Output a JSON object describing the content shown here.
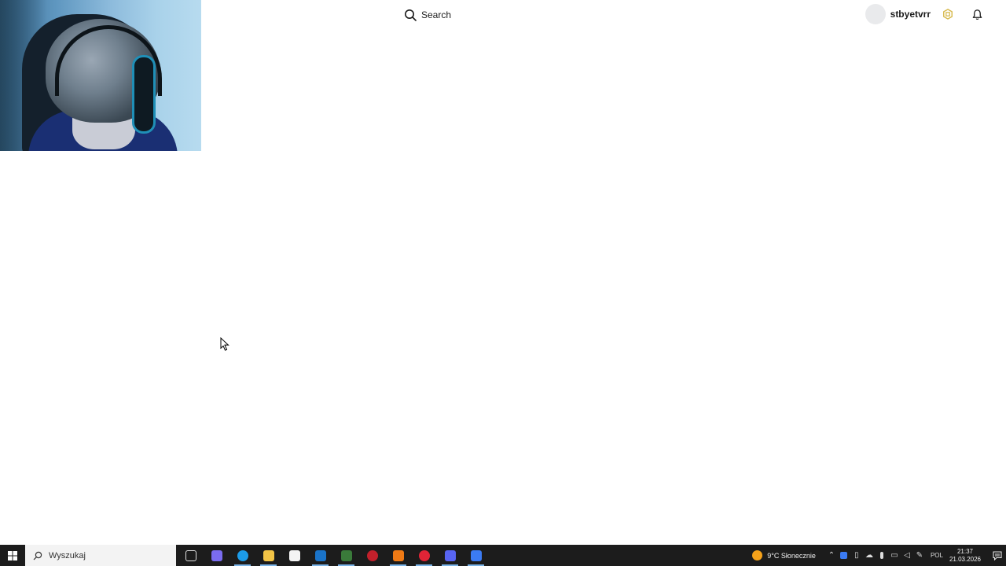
{
  "header": {
    "search_label": "Search",
    "username": "stbyetvrr"
  },
  "taskbar": {
    "search_placeholder": "Wyszukaj",
    "apps": [
      {
        "name": "task-view",
        "color": "#e0e0e0"
      },
      {
        "name": "copilot",
        "color": "#7a6cf0"
      },
      {
        "name": "edge",
        "color": "#1c9be8"
      },
      {
        "name": "file-explorer",
        "color": "#f3c446"
      },
      {
        "name": "microsoft-store",
        "color": "#f4f4f4"
      },
      {
        "name": "outlook",
        "color": "#1a73c8"
      },
      {
        "name": "app-green",
        "color": "#3a7a3a"
      },
      {
        "name": "app-redblack",
        "color": "#c2202b"
      },
      {
        "name": "microphone-app",
        "color": "#ef7a15"
      },
      {
        "name": "opera",
        "color": "#e02436"
      },
      {
        "name": "discord",
        "color": "#5865f2"
      },
      {
        "name": "roblox",
        "color": "#3b7bf3"
      }
    ],
    "weather": "9°C Słonecznie",
    "language": "POL",
    "time": "21:37",
    "date": "21.03.2026"
  },
  "colors": {
    "taskbar_bg": "#1c1c1c",
    "accent": "#7ab4e8"
  }
}
